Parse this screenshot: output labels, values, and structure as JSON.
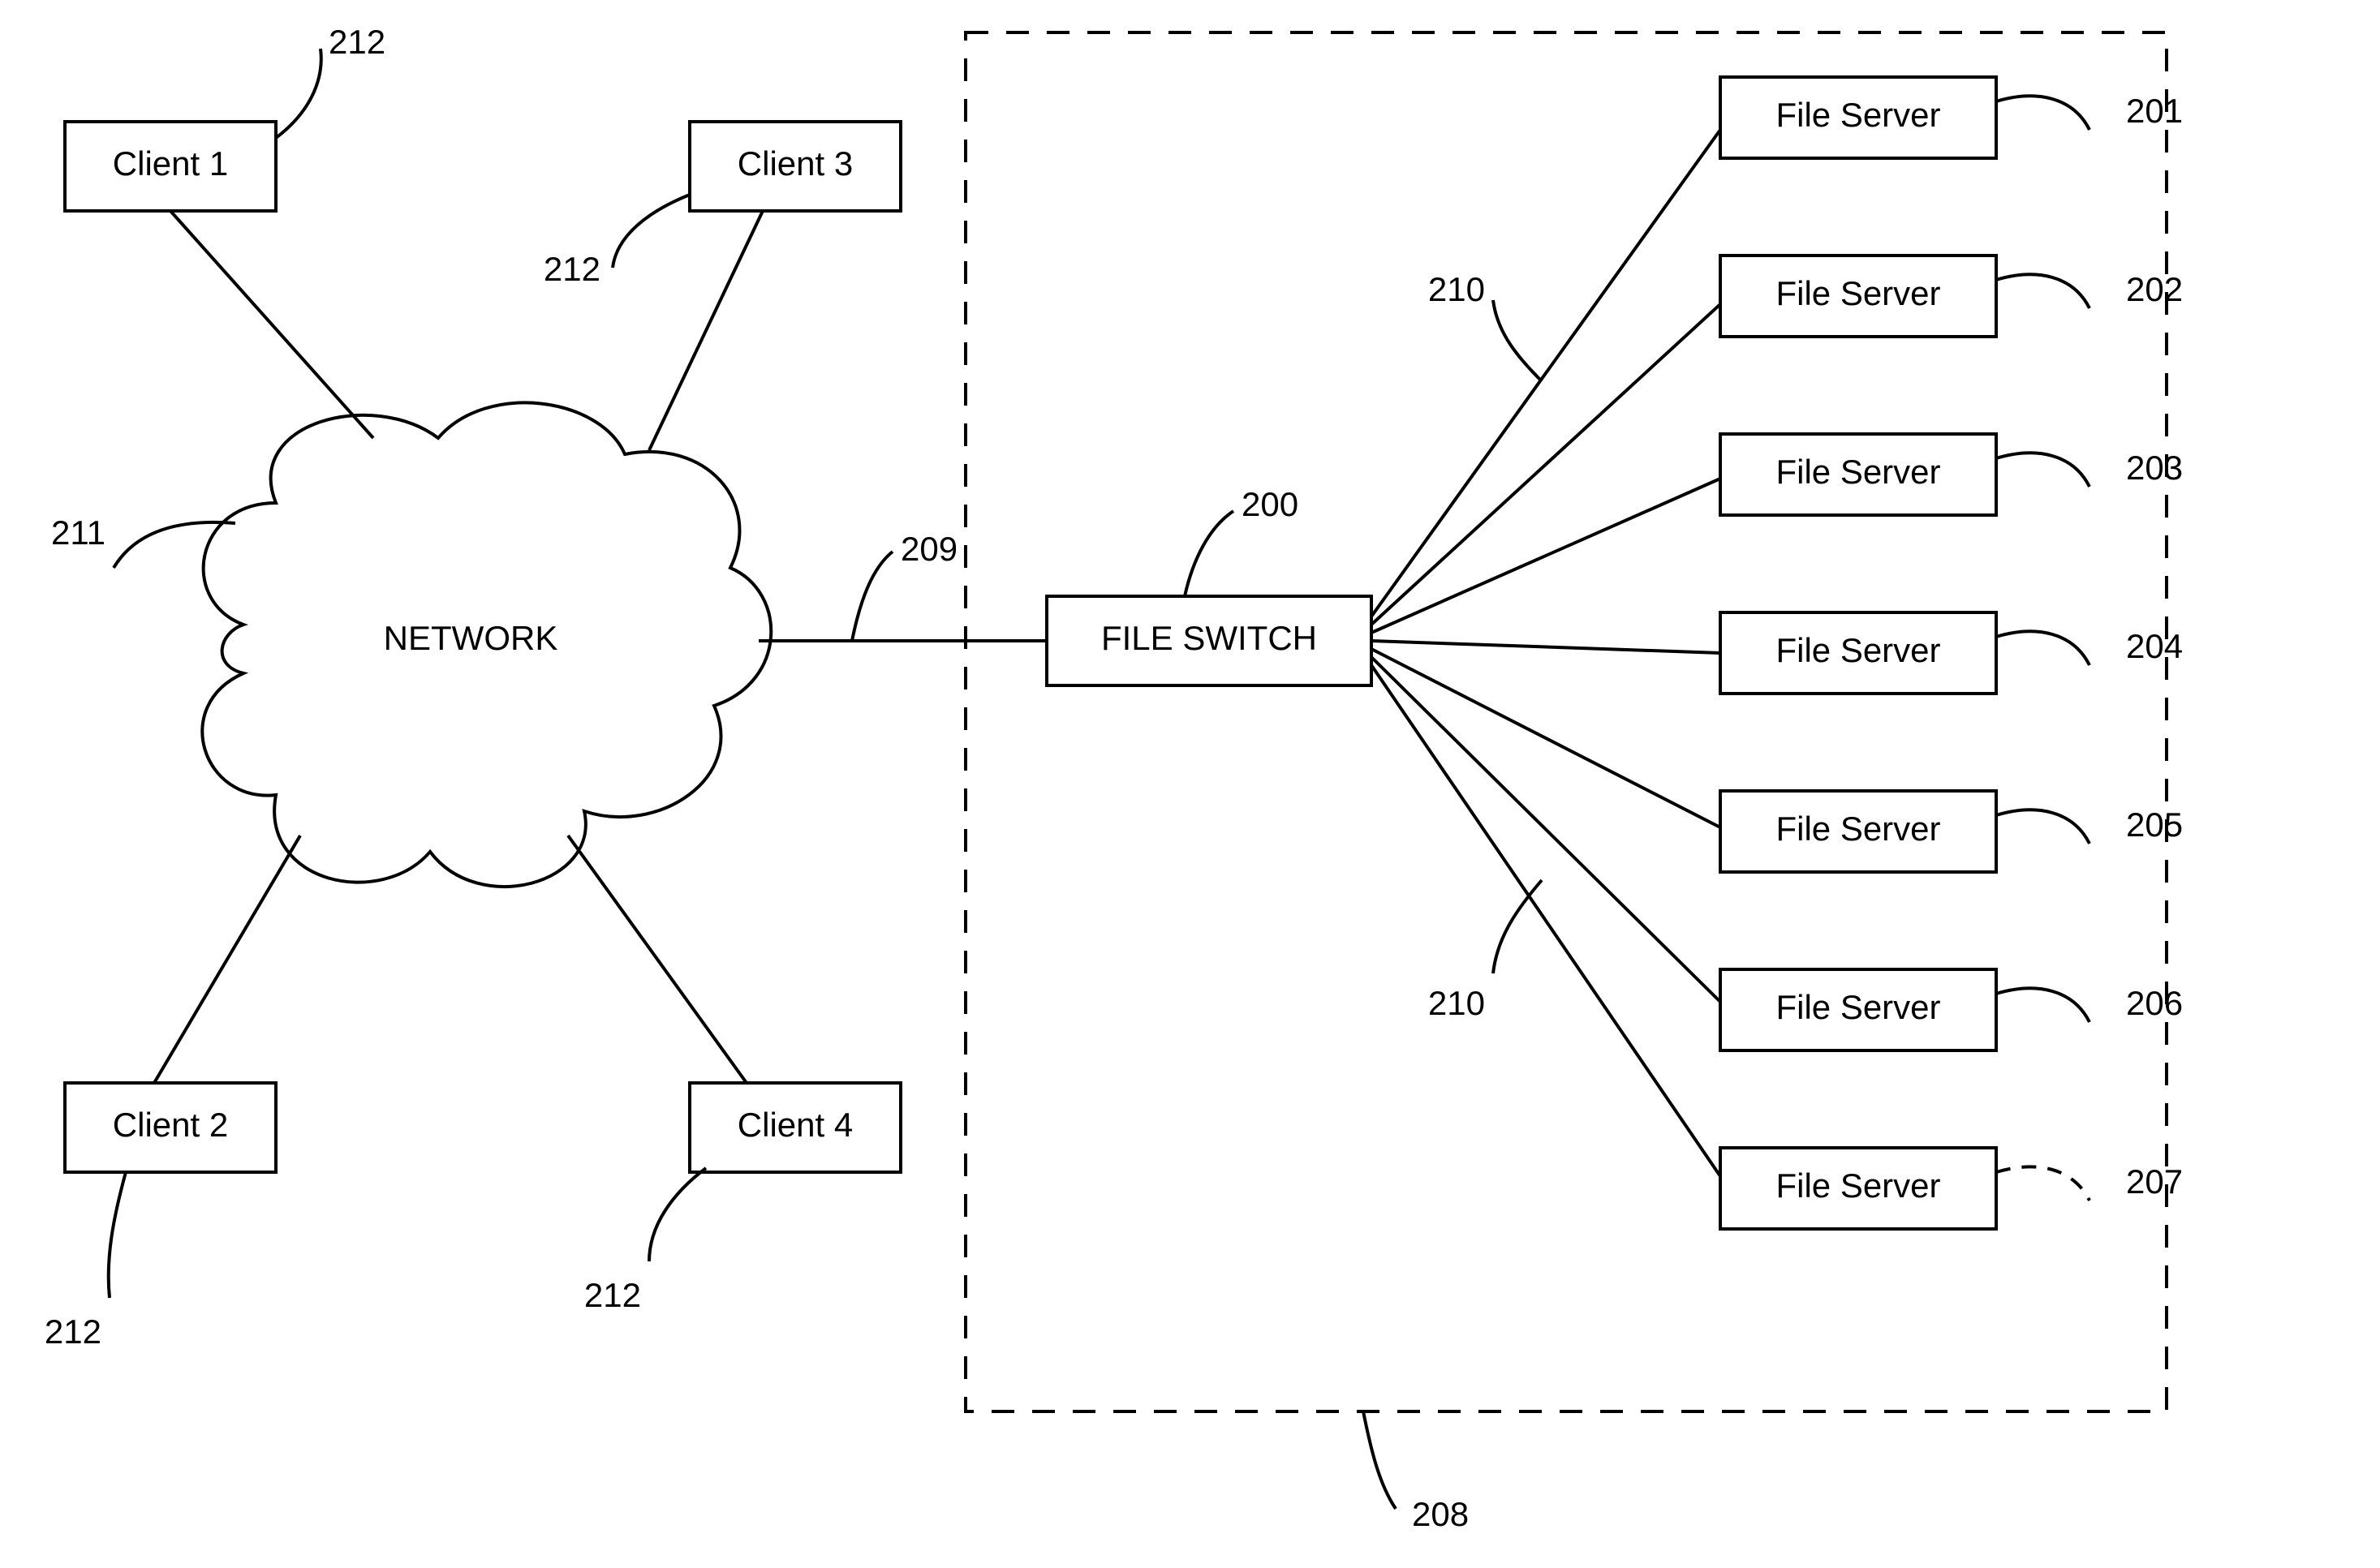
{
  "clients": {
    "c1": "Client 1",
    "c2": "Client 2",
    "c3": "Client 3",
    "c4": "Client 4"
  },
  "network": "NETWORK",
  "fileswitch": "FILE SWITCH",
  "servers": {
    "s1": "File Server",
    "s2": "File Server",
    "s3": "File Server",
    "s4": "File Server",
    "s5": "File Server",
    "s6": "File Server",
    "s7": "File Server"
  },
  "refs": {
    "r200": "200",
    "r201": "201",
    "r202": "202",
    "r203": "203",
    "r204": "204",
    "r205": "205",
    "r206": "206",
    "r207": "207",
    "r208": "208",
    "r209": "209",
    "r210a": "210",
    "r210b": "210",
    "r211": "211",
    "r212a": "212",
    "r212b": "212",
    "r212c": "212",
    "r212d": "212"
  }
}
